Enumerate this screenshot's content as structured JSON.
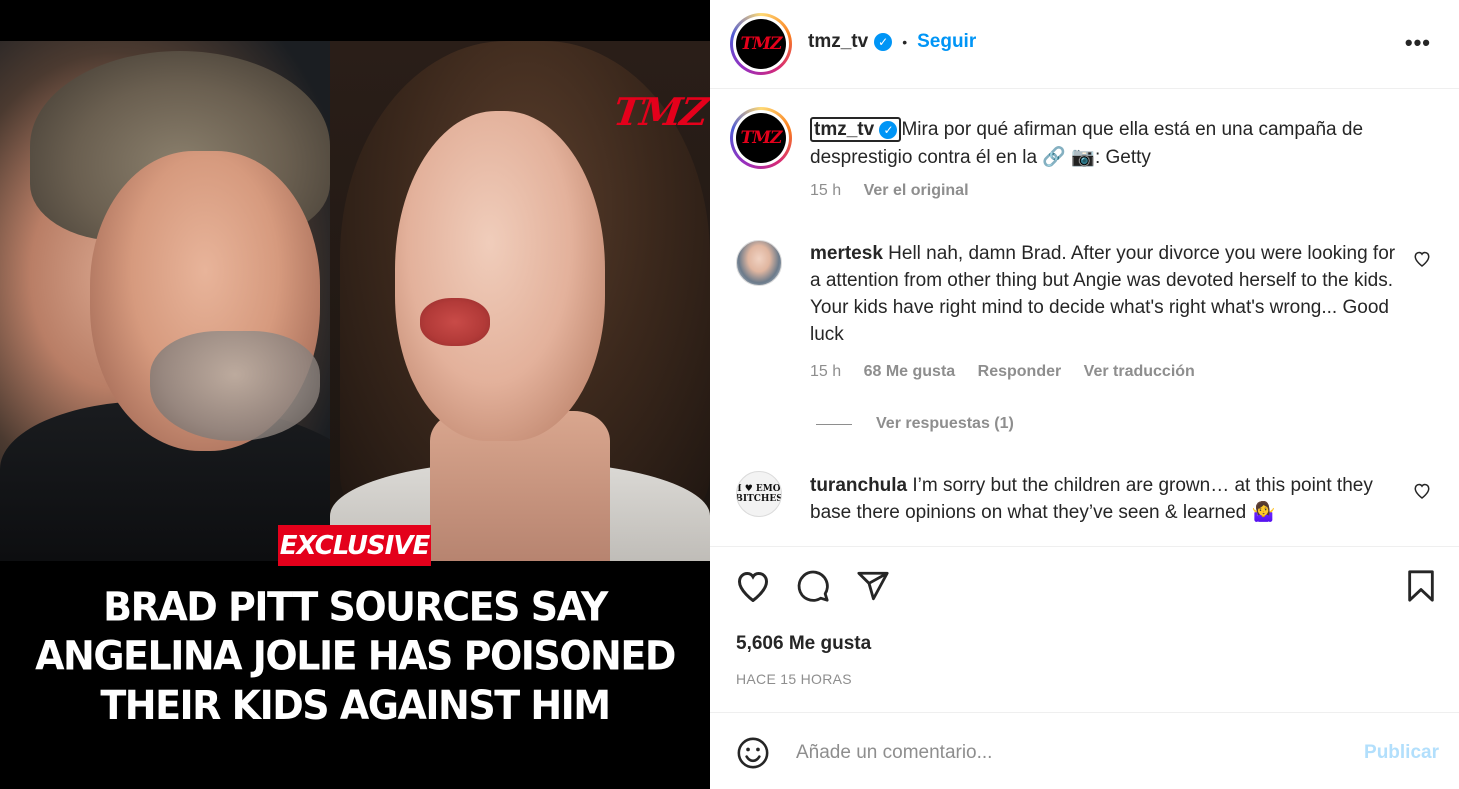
{
  "media": {
    "brand_logo": "TMZ",
    "badge": "EXCLUSIVE",
    "headline_lines": [
      "BRAD PITT SOURCES SAY",
      "ANGELINA JOLIE HAS POISONED",
      "THEIR KIDS AGAINST HIM"
    ]
  },
  "header": {
    "avatar_text": "TMZ",
    "username": "tmz_tv",
    "verified_icon": "verified-badge-icon",
    "separator": "•",
    "follow_label": "Seguir",
    "more_icon": "•••"
  },
  "caption": {
    "username": "tmz_tv",
    "text": "Mira por qué afirman que ella está en una campaña de desprestigio contra él en la 🔗 📷: Getty",
    "time": "15 h",
    "see_original": "Ver el original"
  },
  "comments": [
    {
      "username": "mertesk",
      "text": "Hell nah, damn Brad. After your divorce you were looking for a attention from other thing but Angie was devoted herself to the kids. Your kids have right mind to decide what's right what's wrong... Good luck",
      "time": "15 h",
      "likes": "68 Me gusta",
      "reply": "Responder",
      "translate": "Ver traducción",
      "view_replies": "Ver respuestas (1)"
    },
    {
      "username": "turanchula",
      "text": "I’m sorry but the children are grown… at this point they base there opinions on what they’ve seen & learned 🤷‍♀️",
      "avatar_lines": [
        "I ♥ EMO",
        "BITCHES"
      ]
    }
  ],
  "actions": {
    "like_icon": "heart-icon",
    "comment_icon": "comment-icon",
    "share_icon": "send-icon",
    "save_icon": "bookmark-icon",
    "likes_count": "5,606 Me gusta",
    "date": "HACE 15 HORAS"
  },
  "add_comment": {
    "emoji_icon": "emoji-icon",
    "placeholder": "Añade un comentario...",
    "publish_label": "Publicar"
  },
  "colors": {
    "tmz_red": "#e4001b",
    "link_blue": "#0095f6",
    "muted": "#8e8e8e",
    "publish_disabled": "#b2dffc"
  }
}
